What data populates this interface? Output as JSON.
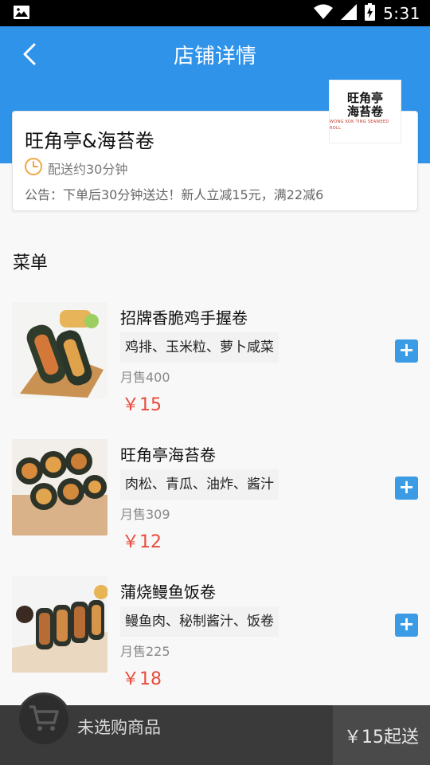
{
  "status_bar": {
    "time": "5:31"
  },
  "header": {
    "title": "店铺详情"
  },
  "shop": {
    "name": "旺角亭&海苔卷",
    "delivery_time": "配送约30分钟",
    "notice": "公告：下单后30分钟送达！新人立减15元，满22减6",
    "logo": {
      "line1": "旺角亭",
      "line2": "海苔卷",
      "sub": "WONG KOK TING SEAWEED ROLL"
    }
  },
  "menu": {
    "heading": "菜单",
    "items": [
      {
        "name": "招牌香脆鸡手握卷",
        "tags": "鸡排、玉米粒、萝卜咸菜",
        "sales": "月售400",
        "price": "￥15"
      },
      {
        "name": "旺角亭海苔卷",
        "tags": "肉松、青瓜、油炸、酱汁",
        "sales": "月售309",
        "price": "￥12"
      },
      {
        "name": "蒲烧鳗鱼饭卷",
        "tags": "鳗鱼肉、秘制酱汁、饭卷",
        "sales": "月售225",
        "price": "￥18"
      }
    ]
  },
  "cart": {
    "status": "未选购商品",
    "min_order": "￥15起送"
  },
  "colors": {
    "brand_blue": "#2f93ea",
    "price_red": "#e84c3d",
    "add_button": "#3b9be5",
    "cart_bar": "#3a3a3a"
  },
  "icons": [
    "image-icon",
    "wifi-icon",
    "signal-icon",
    "battery-icon",
    "back-arrow-icon",
    "clock-icon",
    "plus-icon",
    "cart-icon"
  ]
}
